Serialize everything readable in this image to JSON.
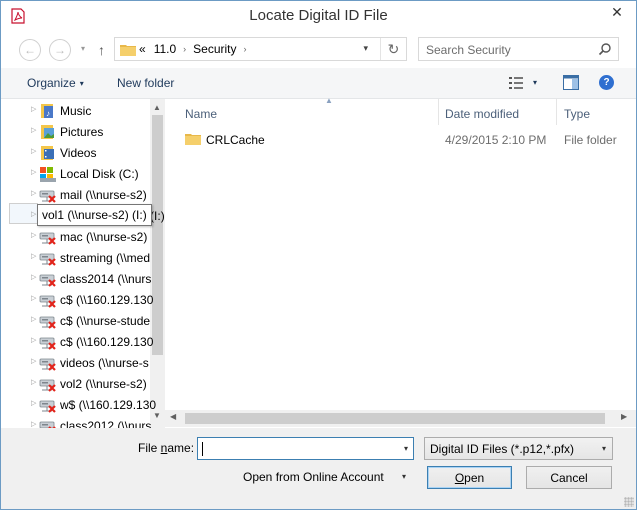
{
  "window": {
    "title": "Locate Digital ID File",
    "close_glyph": "✕"
  },
  "navigation": {
    "back_glyph": "←",
    "forward_glyph": "→",
    "recent_glyph": "▾",
    "up_glyph": "↑",
    "address": {
      "overflow": "«",
      "segments": [
        "11.0",
        "Security"
      ],
      "separator": "›",
      "dropdown_glyph": "▾",
      "refresh_glyph": "↻"
    },
    "search": {
      "placeholder": "Search Security"
    }
  },
  "toolbar": {
    "organize_label": "Organize",
    "new_folder_label": "New folder",
    "caret": "▾",
    "help_glyph": "?"
  },
  "nav_tree": {
    "items": [
      {
        "label": "Music",
        "icon": "music-library-icon"
      },
      {
        "label": "Pictures",
        "icon": "pictures-library-icon"
      },
      {
        "label": "Videos",
        "icon": "videos-library-icon"
      },
      {
        "label": "Local Disk (C:)",
        "icon": "local-disk-icon"
      },
      {
        "label": "mail (\\\\nurse-s2)",
        "icon": "disconnected-network-drive-icon"
      },
      {
        "label": "vol1 (\\\\nurse-s2) (I:)",
        "icon": "disconnected-network-drive-icon"
      },
      {
        "label": "mac (\\\\nurse-s2)",
        "icon": "disconnected-network-drive-icon"
      },
      {
        "label": "streaming (\\\\med",
        "icon": "disconnected-network-drive-icon"
      },
      {
        "label": "class2014 (\\\\nurs",
        "icon": "disconnected-network-drive-icon"
      },
      {
        "label": "c$ (\\\\160.129.130",
        "icon": "disconnected-network-drive-icon"
      },
      {
        "label": "c$ (\\\\nurse-stude",
        "icon": "disconnected-network-drive-icon"
      },
      {
        "label": "c$ (\\\\160.129.130",
        "icon": "disconnected-network-drive-icon"
      },
      {
        "label": "videos (\\\\nurse-s",
        "icon": "disconnected-network-drive-icon"
      },
      {
        "label": "vol2 (\\\\nurse-s2)",
        "icon": "disconnected-network-drive-icon"
      },
      {
        "label": "w$ (\\\\160.129.130",
        "icon": "disconnected-network-drive-icon"
      },
      {
        "label": "class2012 (\\\\nurs",
        "icon": "disconnected-network-drive-icon"
      }
    ],
    "tooltip": "vol1 (\\\\nurse-s2) (I:)",
    "expand_glyph": "▷"
  },
  "file_list": {
    "columns": [
      "Name",
      "Date modified",
      "Type"
    ],
    "sort_glyph": "▲",
    "rows": [
      {
        "name": "CRLCache",
        "date_modified": "4/29/2015 2:10 PM",
        "type": "File folder"
      }
    ]
  },
  "scrollbars": {
    "up": "▲",
    "down": "▼",
    "left": "◀",
    "right": "▶"
  },
  "bottom": {
    "file_name_label_pre": "File ",
    "file_name_label_accel": "n",
    "file_name_label_post": "ame:",
    "file_name_value": "",
    "dropdown_glyph": "▾",
    "filter_value": "Digital ID Files (*.p12,*.pfx)",
    "online_account_label": "Open from Online Account",
    "open_accel": "O",
    "open_rest": "pen",
    "cancel_label": "Cancel"
  }
}
